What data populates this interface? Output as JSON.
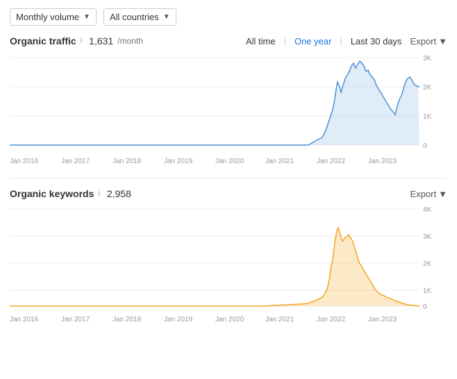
{
  "topBar": {
    "dropdown1": {
      "label": "Monthly volume",
      "arrow": "▼"
    },
    "dropdown2": {
      "label": "All countries",
      "arrow": "▼"
    }
  },
  "organicTraffic": {
    "title": "Organic traffic",
    "info": "i",
    "value": "1,631",
    "unit": "/month",
    "filters": {
      "allTime": "All time",
      "oneYear": "One year",
      "last30": "Last 30 days"
    },
    "export": "Export",
    "exportArrow": "▼"
  },
  "organicKeywords": {
    "title": "Organic keywords",
    "info": "i",
    "value": "2,958",
    "export": "Export",
    "exportArrow": "▼"
  },
  "xLabels": [
    "Jan 2016",
    "Jan 2017",
    "Jan 2018",
    "Jan 2019",
    "Jan 2020",
    "Jan 2021",
    "Jan 2022",
    "Jan 2023"
  ],
  "chart1": {
    "yLabels": [
      "3K",
      "2K",
      "1K",
      "0"
    ]
  },
  "chart2": {
    "yLabels": [
      "4K",
      "3K",
      "2K",
      "1K",
      "0"
    ]
  }
}
